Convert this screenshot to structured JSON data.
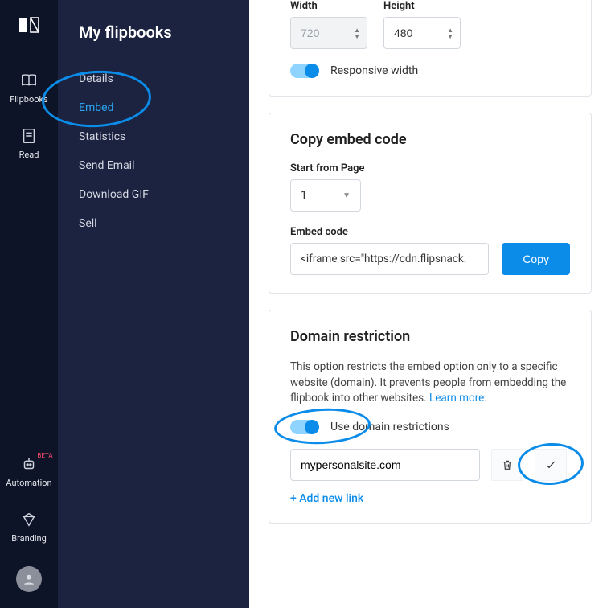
{
  "rail": {
    "items": [
      {
        "label": "Flipbooks",
        "icon": "book-open"
      },
      {
        "label": "Read",
        "icon": "page"
      }
    ],
    "bottom_items": [
      {
        "label": "Automation",
        "icon": "robot",
        "badge": "BETA"
      },
      {
        "label": "Branding",
        "icon": "diamond"
      }
    ]
  },
  "subnav": {
    "title": "My flipbooks",
    "items": [
      {
        "label": "Details"
      },
      {
        "label": "Embed",
        "active": true
      },
      {
        "label": "Statistics"
      },
      {
        "label": "Send Email"
      },
      {
        "label": "Download GIF"
      },
      {
        "label": "Sell"
      }
    ]
  },
  "dimensions": {
    "width_label": "Width",
    "height_label": "Height",
    "width_value": "720",
    "height_value": "480",
    "responsive_label": "Responsive width"
  },
  "embed": {
    "title": "Copy embed code",
    "startfrom_label": "Start from Page",
    "startfrom_value": "1",
    "code_label": "Embed code",
    "code_value": "<iframe src=\"https://cdn.flipsnack.",
    "copy_button": "Copy"
  },
  "domain": {
    "title": "Domain restriction",
    "desc_a": "This option restricts the embed option only to a specific website (domain). It prevents people from embedding the flipbook into other websites. ",
    "learn_more": "Learn more",
    "desc_b": ".",
    "toggle_label": "Use domain restrictions",
    "input_value": "mypersonalsite.com",
    "add_link": "+ Add new link"
  }
}
